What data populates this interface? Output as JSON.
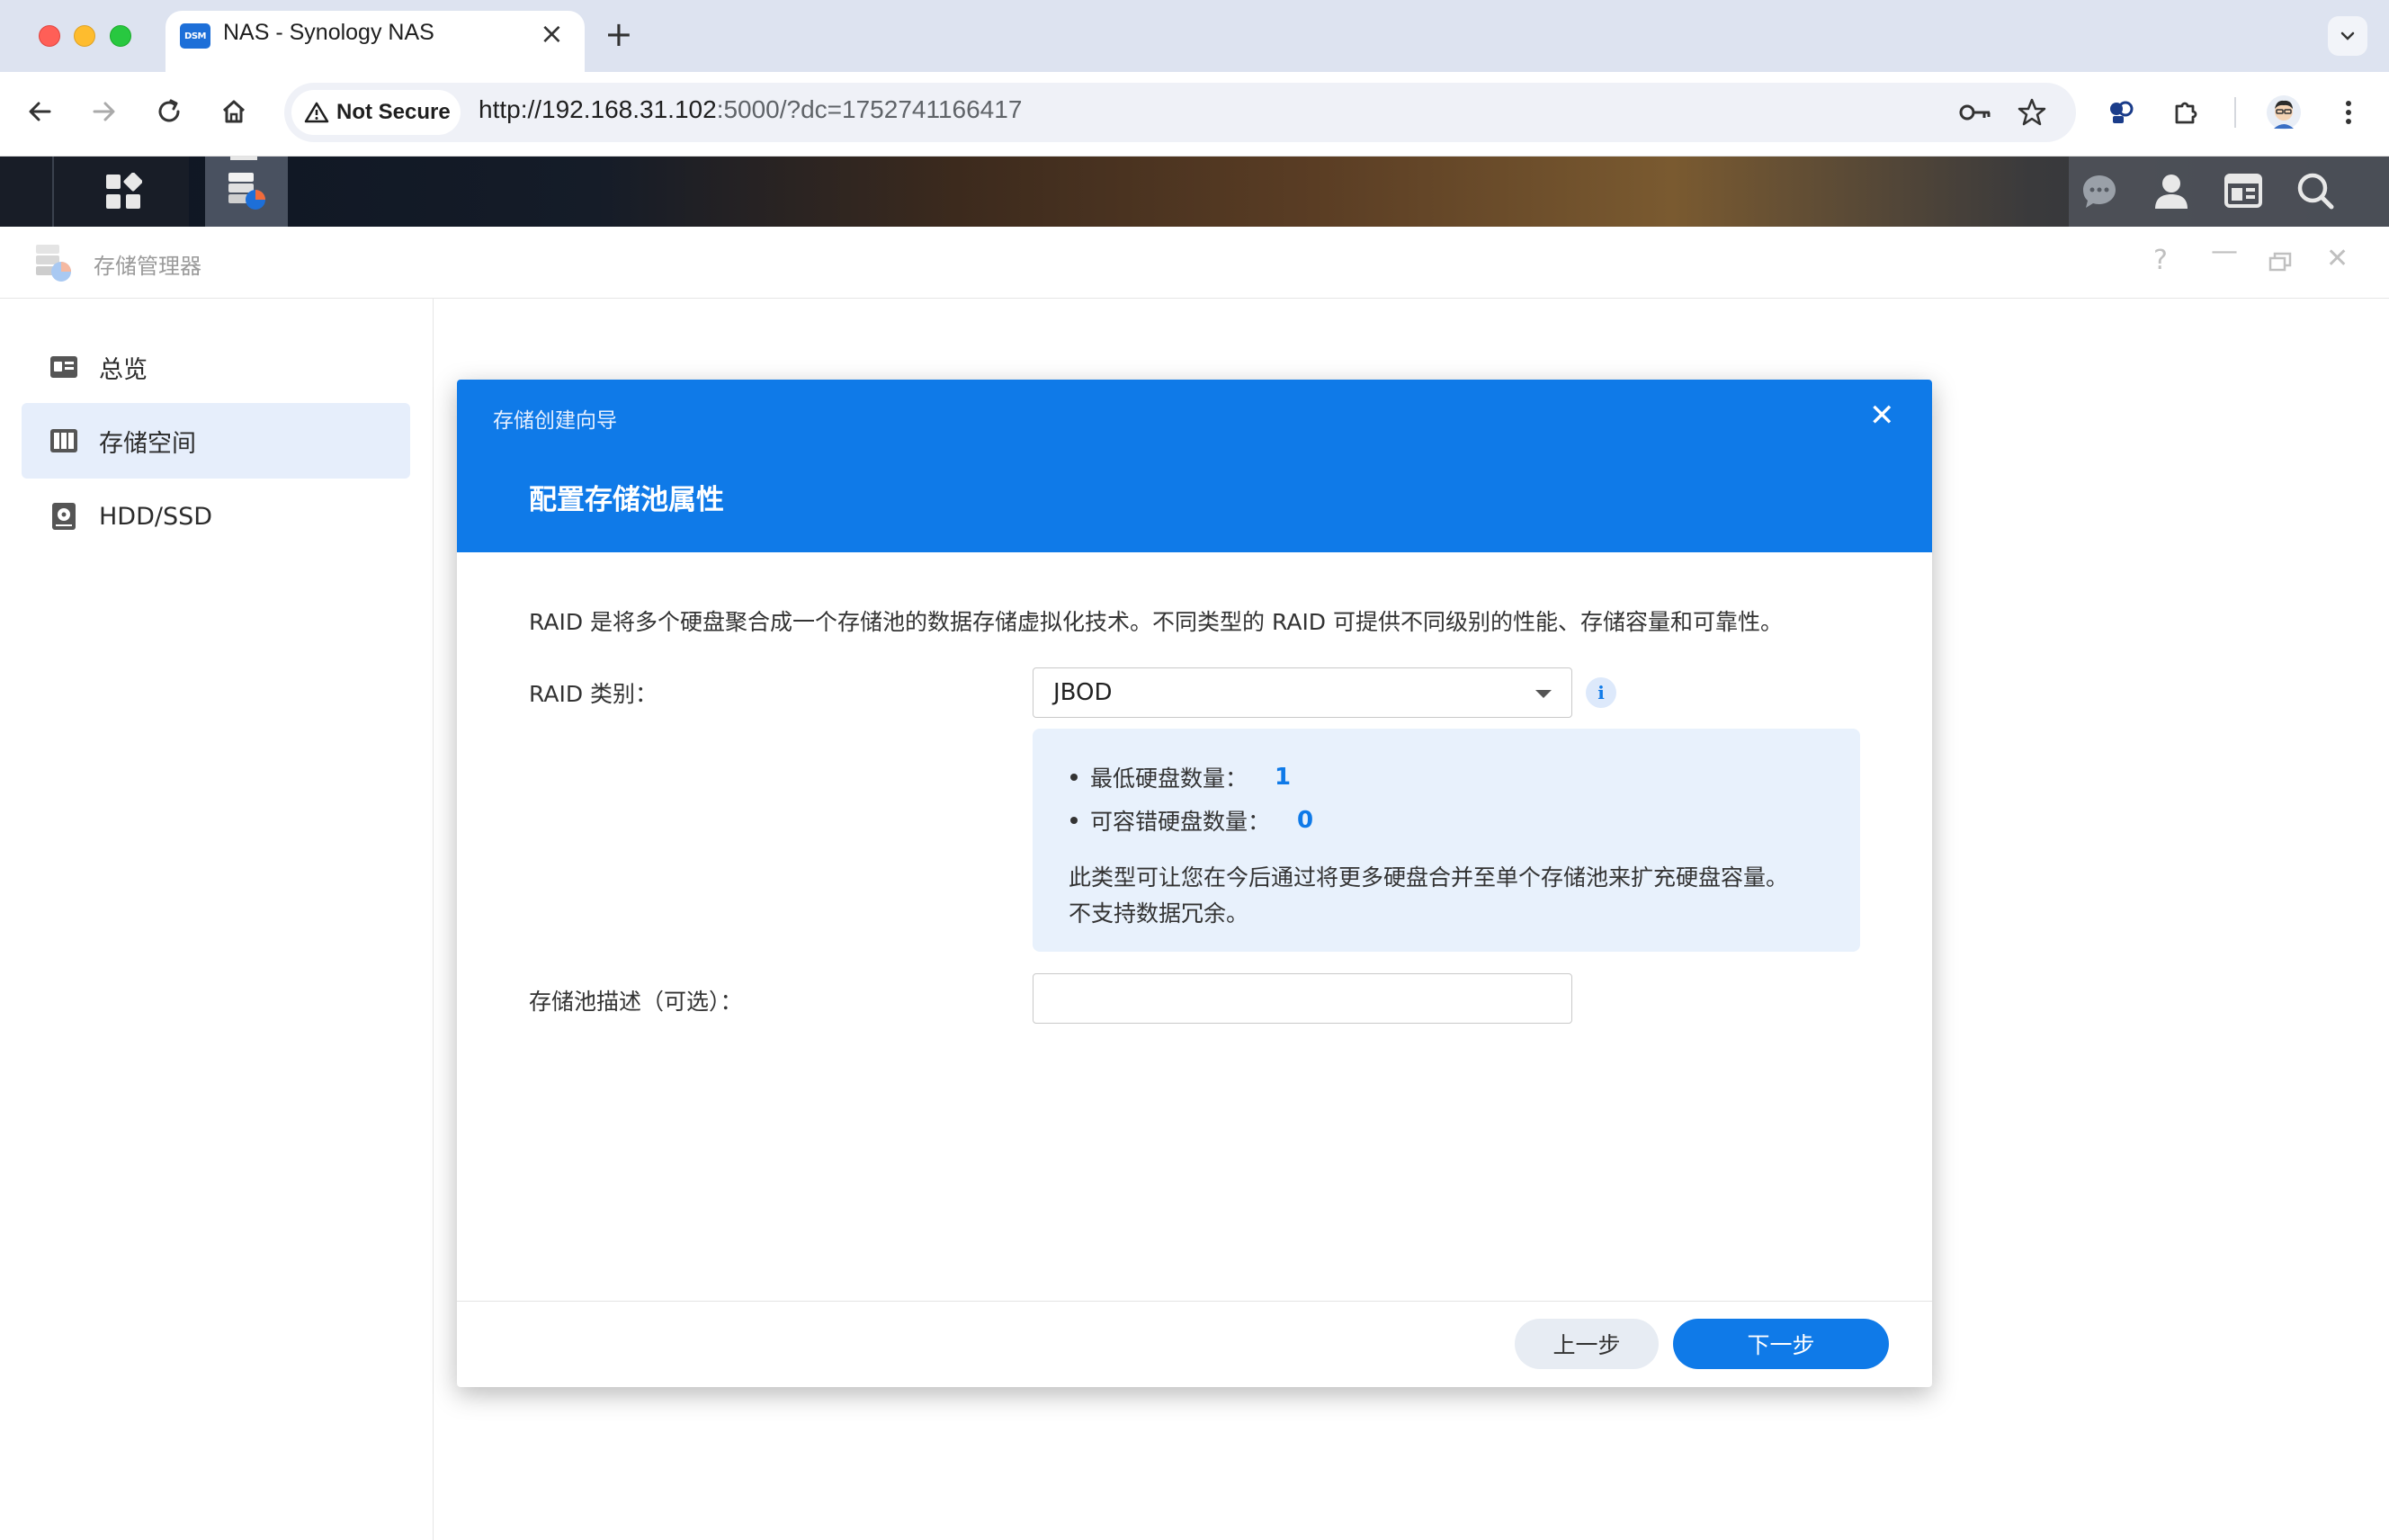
{
  "browser": {
    "tab_title": "NAS - Synology NAS",
    "tab_favicon_text": "DSM",
    "security_chip": "Not Secure",
    "url_host": "http://192.168.31.102",
    "url_rest": ":5000/?dc=1752741166417"
  },
  "app": {
    "title": "存储管理器",
    "sidebar": [
      {
        "label": "总览",
        "icon": "overview-icon"
      },
      {
        "label": "存储空间",
        "icon": "storage-icon",
        "active": true
      },
      {
        "label": "HDD/SSD",
        "icon": "disk-icon"
      }
    ]
  },
  "dialog": {
    "wizard_title": "存储创建向导",
    "heading": "配置存储池属性",
    "description": "RAID 是将多个硬盘聚合成一个存储池的数据存储虚拟化技术。不同类型的 RAID 可提供不同级别的性能、存储容量和可靠性。",
    "raid_label": "RAID 类别：",
    "raid_value": "JBOD",
    "info": {
      "min_disks_label": "最低硬盘数量：",
      "min_disks_value": "1",
      "fault_tolerance_label": "可容错硬盘数量：",
      "fault_tolerance_value": "0",
      "note_line1": "此类型可让您在今后通过将更多硬盘合并至单个存储池来扩充硬盘容量。",
      "note_line2": "不支持数据冗余。"
    },
    "pool_desc_label": "存储池描述（可选）：",
    "pool_desc_value": "",
    "prev_button": "上一步",
    "next_button": "下一步"
  },
  "colors": {
    "accent": "#0f7ae8",
    "info_bg": "#e8f1fc",
    "sidebar_active": "#e6eefb"
  }
}
